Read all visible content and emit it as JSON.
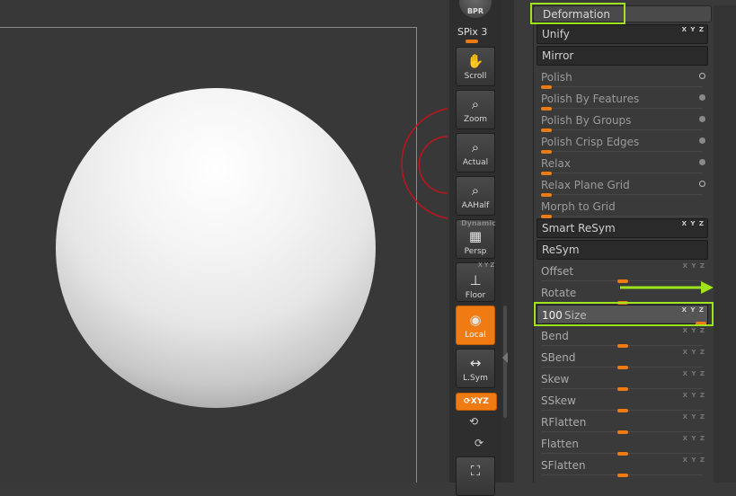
{
  "shelf": {
    "bpr": "BPR",
    "spix": "SPix 3",
    "buttons": [
      {
        "label": "Scroll",
        "icon": "hand-icon"
      },
      {
        "label": "Zoom",
        "icon": "magnifier-icon"
      },
      {
        "label": "Actual",
        "icon": "magnifier-icon"
      },
      {
        "label": "AAHalf",
        "icon": "magnifier-icon"
      },
      {
        "label": "Persp",
        "icon": "grid-icon"
      },
      {
        "label": "Floor",
        "icon": "floor-icon"
      },
      {
        "label": "Local",
        "icon": "local-icon"
      },
      {
        "label": "L.Sym",
        "icon": "symmetry-icon"
      }
    ],
    "dynamic": "Dynamic",
    "xyz": "XYZ",
    "floor_axes": "X Y Z"
  },
  "palette": {
    "title": "Deformation",
    "rows": [
      {
        "name": "Unify",
        "type": "button",
        "axes": "X Y Z"
      },
      {
        "name": "Mirror",
        "type": "button"
      },
      {
        "name": "Polish",
        "type": "polish",
        "dot": "hollow"
      },
      {
        "name": "Polish By Features",
        "type": "polish",
        "dot": "solid"
      },
      {
        "name": "Polish By Groups",
        "type": "polish",
        "dot": "solid"
      },
      {
        "name": "Polish Crisp Edges",
        "type": "polish",
        "dot": "solid"
      },
      {
        "name": "Relax",
        "type": "polish",
        "dot": "solid"
      },
      {
        "name": "Relax Plane Grid",
        "type": "polish",
        "dot": "hollow"
      },
      {
        "name": "Morph to Grid",
        "type": "polish"
      },
      {
        "name": "Smart ReSym",
        "type": "button",
        "axes": "X Y Z"
      },
      {
        "name": "ReSym",
        "type": "button"
      },
      {
        "name": "Offset",
        "type": "slider",
        "axes": "X Y Z"
      },
      {
        "name": "Rotate",
        "type": "slider"
      },
      {
        "name": "Size",
        "type": "size",
        "value": "100",
        "axes": "X Y Z"
      },
      {
        "name": "Bend",
        "type": "slider",
        "axes": "X Y Z"
      },
      {
        "name": "SBend",
        "type": "slider",
        "axes": "X Y Z"
      },
      {
        "name": "Skew",
        "type": "slider",
        "axes": "X Y Z"
      },
      {
        "name": "SSkew",
        "type": "slider",
        "axes": "X Y Z"
      },
      {
        "name": "RFlatten",
        "type": "slider",
        "axes": "X Y Z"
      },
      {
        "name": "Flatten",
        "type": "slider",
        "axes": "X Y Z"
      },
      {
        "name": "SFlatten",
        "type": "slider",
        "axes": "X Y Z"
      }
    ]
  },
  "colors": {
    "accent": "#f07b12",
    "highlight": "#9fe31f",
    "annotation": "#c0141c"
  }
}
